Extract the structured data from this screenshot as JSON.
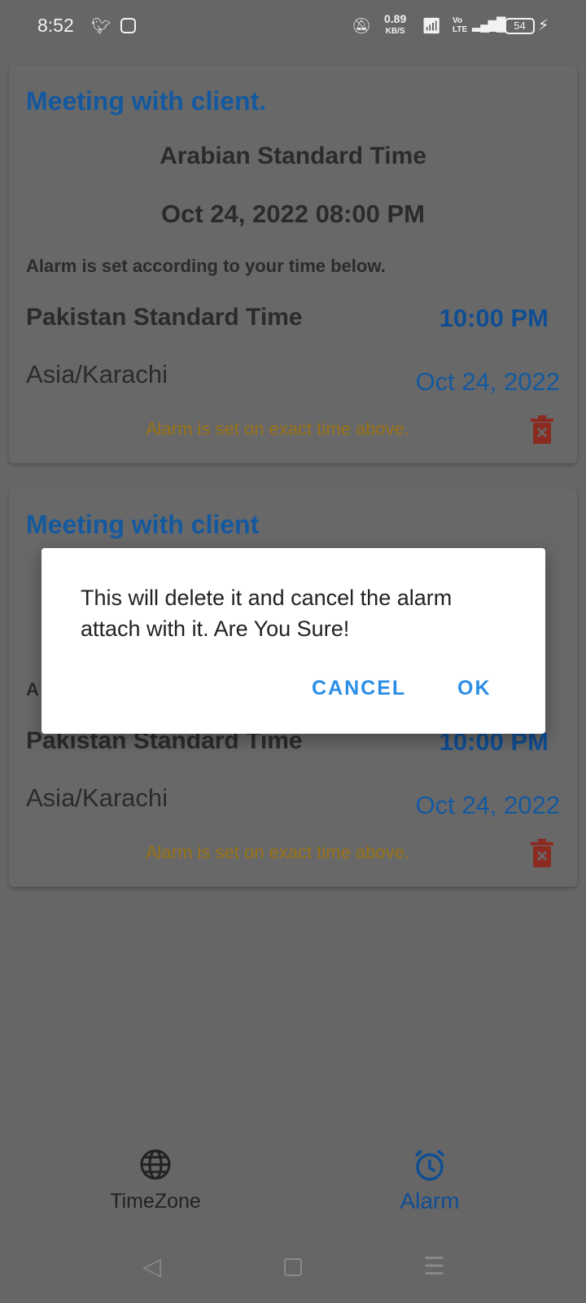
{
  "status_bar": {
    "time": "8:52",
    "notifications": [
      "twitter-icon",
      "instagram-icon"
    ],
    "net_speed": "0.89",
    "net_unit": "KB/S",
    "volte": "Vo LTE",
    "battery": "54"
  },
  "alarms": [
    {
      "title": "Meeting with client.",
      "source_timezone": "Arabian Standard Time",
      "source_datetime": "Oct 24, 2022 08:00 PM",
      "note": "Alarm is set according to your time below.",
      "local_timezone": "Pakistan Standard Time",
      "local_time": "10:00 PM",
      "local_zone_id": "Asia/Karachi",
      "local_date": "Oct 24, 2022",
      "exact_note": "Alarm is set on exact time above."
    },
    {
      "title": "Meeting with client",
      "source_timezone": "",
      "source_datetime": "",
      "note": "A",
      "local_timezone": "Pakistan Standard Time",
      "local_time": "10:00 PM",
      "local_zone_id": "Asia/Karachi",
      "local_date": "Oct 24, 2022",
      "exact_note": "Alarm is set on exact time above."
    }
  ],
  "dialog": {
    "message": "This will delete it and cancel the alarm attach with it. Are You Sure!",
    "cancel": "CANCEL",
    "ok": "OK"
  },
  "bottom_nav": [
    {
      "label": "TimeZone",
      "icon": "globe-icon",
      "active": false
    },
    {
      "label": "Alarm",
      "icon": "alarm-clock-icon",
      "active": true
    }
  ],
  "colors": {
    "accent": "#2b8ee6",
    "title": "#14599f",
    "warning": "#9a7214",
    "delete": "#8b2a20"
  }
}
